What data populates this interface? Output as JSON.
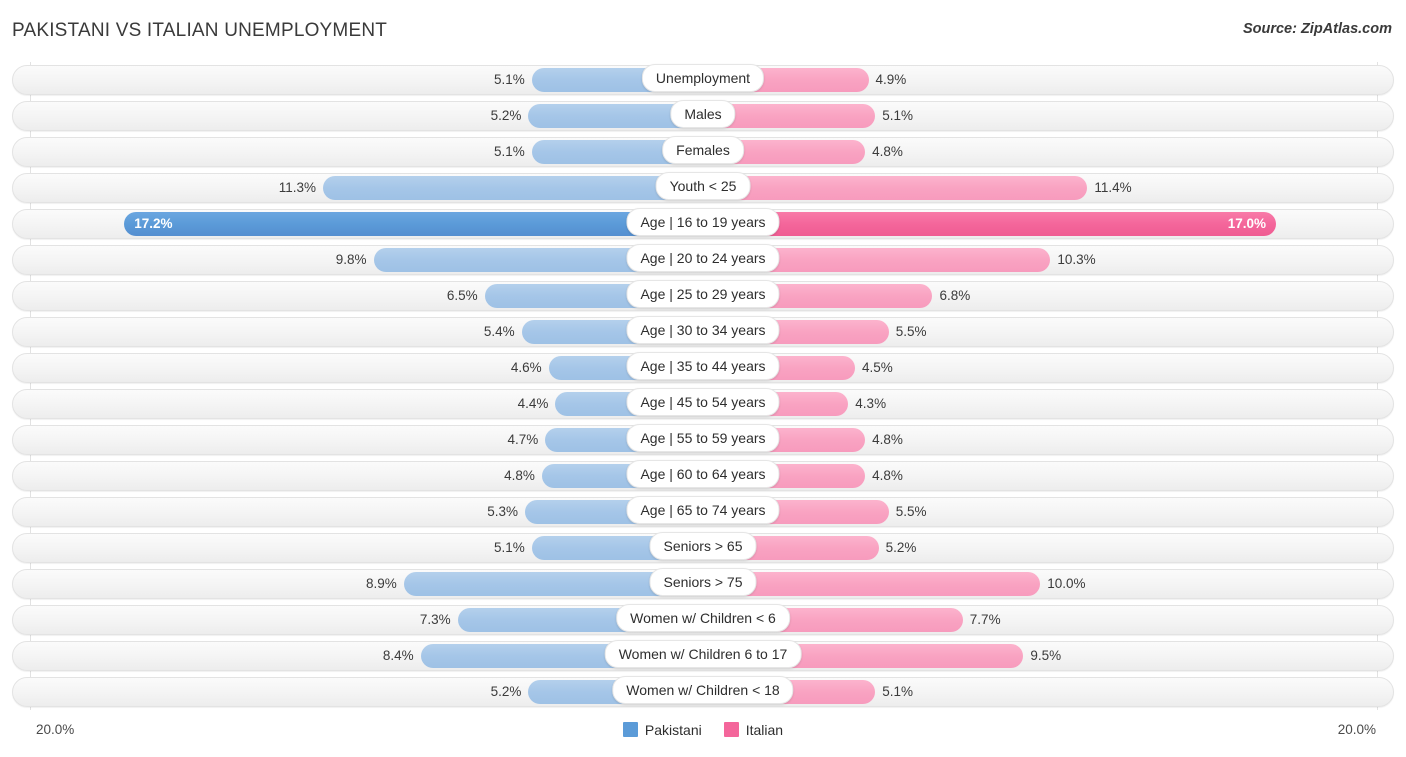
{
  "header": {
    "title": "PAKISTANI VS ITALIAN UNEMPLOYMENT",
    "source": "Source: ZipAtlas.com"
  },
  "axis": {
    "left_label": "20.0%",
    "right_label": "20.0%",
    "max": 20.0
  },
  "legend": {
    "items": [
      {
        "label": "Pakistani",
        "color": "#5b9bd8"
      },
      {
        "label": "Italian",
        "color": "#f4669b"
      }
    ]
  },
  "colors": {
    "blue": "#a5c6e8",
    "blue_highlight": "#5b9bd8",
    "pink": "#f9a3c2",
    "pink_highlight": "#f4669b",
    "track": "#f4f4f4",
    "text": "#3b3b3b"
  },
  "chart_data": {
    "type": "bar",
    "orientation": "horizontal-diverging",
    "title": "PAKISTANI VS ITALIAN UNEMPLOYMENT",
    "xlabel": "",
    "ylabel": "",
    "xlim": [
      20.0,
      20.0
    ],
    "grid": true,
    "legend_position": "bottom-center",
    "categories": [
      "Unemployment",
      "Males",
      "Females",
      "Youth < 25",
      "Age | 16 to 19 years",
      "Age | 20 to 24 years",
      "Age | 25 to 29 years",
      "Age | 30 to 34 years",
      "Age | 35 to 44 years",
      "Age | 45 to 54 years",
      "Age | 55 to 59 years",
      "Age | 60 to 64 years",
      "Age | 65 to 74 years",
      "Seniors > 65",
      "Seniors > 75",
      "Women w/ Children < 6",
      "Women w/ Children 6 to 17",
      "Women w/ Children < 18"
    ],
    "series": [
      {
        "name": "Pakistani",
        "side": "left",
        "values": [
          5.1,
          5.2,
          5.1,
          11.3,
          17.2,
          9.8,
          6.5,
          5.4,
          4.6,
          4.4,
          4.7,
          4.8,
          5.3,
          5.1,
          8.9,
          7.3,
          8.4,
          5.2
        ],
        "labels": [
          "5.1%",
          "5.2%",
          "5.1%",
          "11.3%",
          "17.2%",
          "9.8%",
          "6.5%",
          "5.4%",
          "4.6%",
          "4.4%",
          "4.7%",
          "4.8%",
          "5.3%",
          "5.1%",
          "8.9%",
          "7.3%",
          "8.4%",
          "5.2%"
        ]
      },
      {
        "name": "Italian",
        "side": "right",
        "values": [
          4.9,
          5.1,
          4.8,
          11.4,
          17.0,
          10.3,
          6.8,
          5.5,
          4.5,
          4.3,
          4.8,
          4.8,
          5.5,
          5.2,
          10.0,
          7.7,
          9.5,
          5.1
        ],
        "labels": [
          "4.9%",
          "5.1%",
          "4.8%",
          "11.4%",
          "17.0%",
          "10.3%",
          "6.8%",
          "5.5%",
          "4.5%",
          "4.3%",
          "4.8%",
          "4.8%",
          "5.5%",
          "5.2%",
          "10.0%",
          "7.7%",
          "9.5%",
          "5.1%"
        ]
      }
    ],
    "highlighted_row_index": 4
  }
}
